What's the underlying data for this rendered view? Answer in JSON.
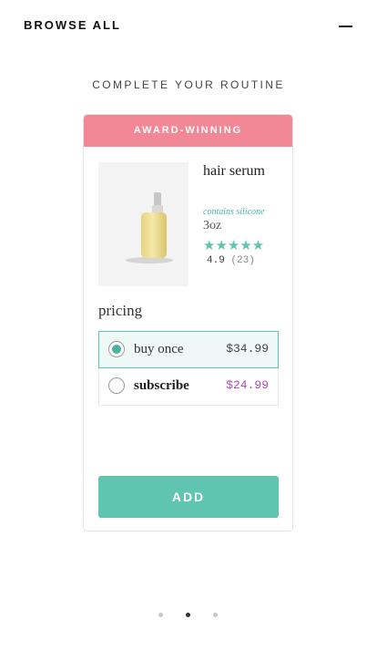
{
  "header": {
    "browse_label": "BROWSE ALL"
  },
  "section": {
    "title": "COMPLETE YOUR ROUTINE"
  },
  "card": {
    "badge": "AWARD-WINNING",
    "product": {
      "name": "hair serum",
      "note": "contains silicone",
      "size": "3oz",
      "stars": "★★★★★",
      "rating": "4.9",
      "review_count": "(23)"
    },
    "pricing": {
      "label": "pricing",
      "options": [
        {
          "label": "buy once",
          "price": "$34.99",
          "selected": true
        },
        {
          "label": "subscribe",
          "price": "$24.99",
          "selected": false
        }
      ]
    },
    "add_label": "ADD"
  },
  "carousel": {
    "page_count": 3,
    "active_index": 1
  },
  "colors": {
    "accent": "#5fc4b0",
    "badge": "#f28795",
    "subscribe_price": "#b049b8"
  },
  "icons": {
    "collapse": "minus-icon",
    "radio_selected": "radio-selected-icon",
    "radio_unselected": "radio-unselected-icon",
    "stars": "star-icon"
  }
}
